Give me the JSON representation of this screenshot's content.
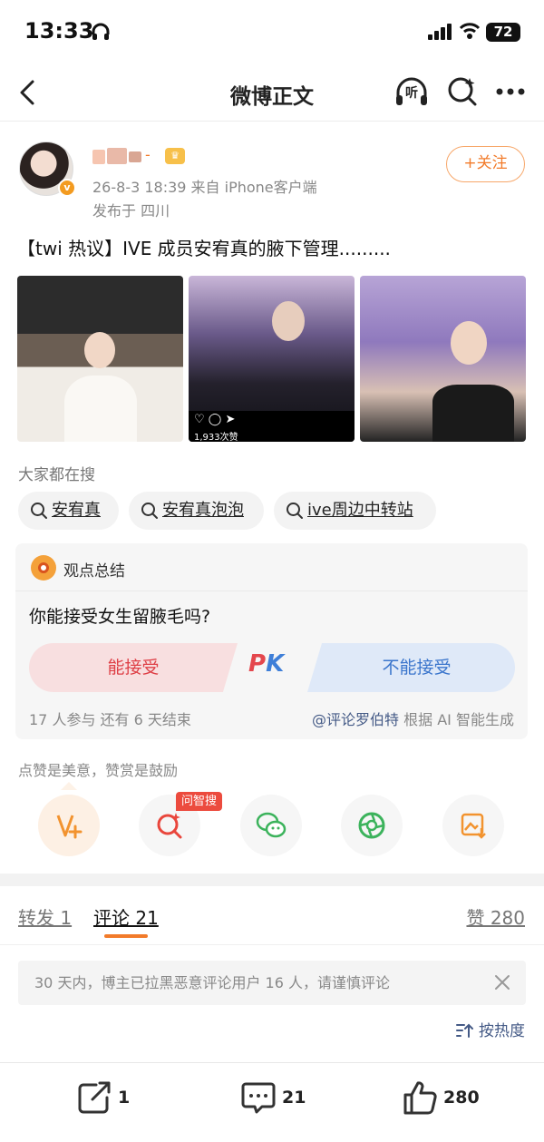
{
  "status_bar": {
    "time": "13:33",
    "battery": "72"
  },
  "nav": {
    "title": "微博正文",
    "listen_label": "听"
  },
  "post": {
    "meta": "26-8-3 18:39  来自 iPhone客户端",
    "location": "发布于 四川",
    "follow_label": "+关注",
    "headline": "【twi 热议】IVE 成员安宥真的腋下管理.........",
    "photo2_likes": "1,933次赞"
  },
  "search": {
    "label": "大家都在搜",
    "chips": [
      "安宥真",
      "安宥真泡泡",
      "ive周边中转站"
    ]
  },
  "viewpoint": {
    "label": "观点总结",
    "question": "你能接受女生留腋毛吗?",
    "yes_label": "能接受",
    "pk_p": "P",
    "pk_k": "K",
    "no_label": "不能接受",
    "stats": "17 人参与   还有 6 天结束",
    "source_name": "@评论罗伯特",
    "source_suffix": " 根据 AI 智能生成"
  },
  "reward": {
    "label": "点赞是美意，赞赏是鼓励",
    "ai_badge": "问智搜"
  },
  "tabs": {
    "repost": "转发 1",
    "comment": "评论 21",
    "like": "赞 280"
  },
  "notice": "30 天内，博主已拉黑恶意评论用户 16 人，请谨慎评论",
  "sort_label": "按热度",
  "bottom_bar": {
    "repost_count": "1",
    "comment_count": "21",
    "like_count": "280"
  },
  "colors": {
    "accent": "#f27b2a",
    "pk_red": "#de3f46",
    "pk_blue": "#3a75cc",
    "link_blue": "#445a86"
  }
}
